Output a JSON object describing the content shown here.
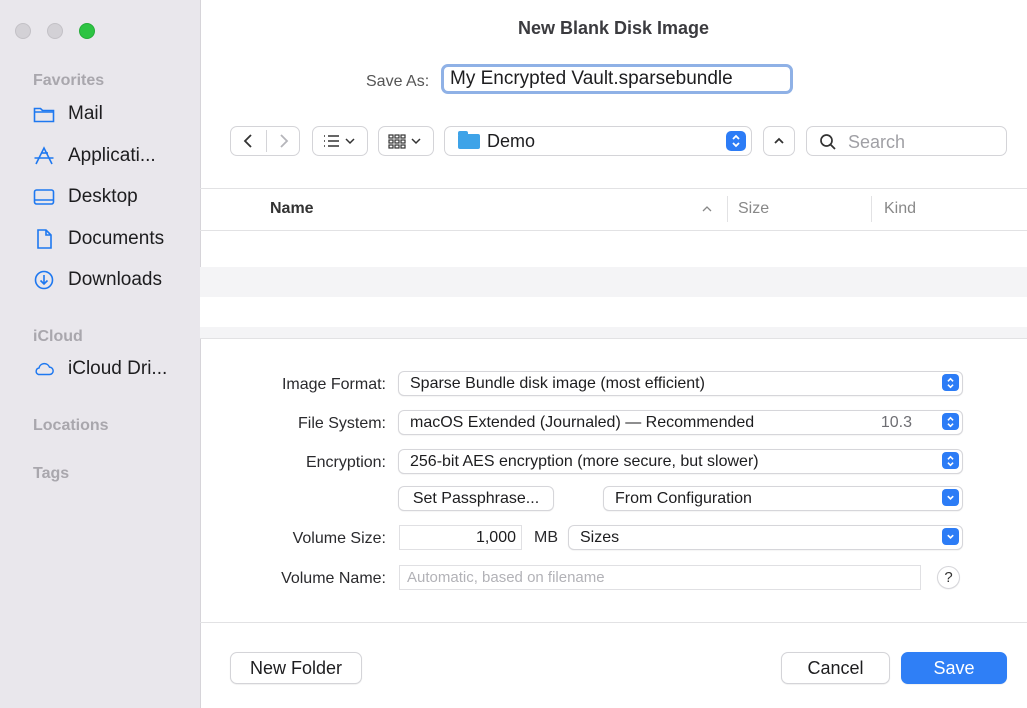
{
  "window": {
    "title": "New Blank Disk Image"
  },
  "sidebar": {
    "sections": {
      "favorites": "Favorites",
      "icloud": "iCloud",
      "locations": "Locations",
      "tags": "Tags"
    },
    "favorites": [
      {
        "label": "Mail",
        "icon": "folder-icon"
      },
      {
        "label": "Applicati...",
        "icon": "applications-icon"
      },
      {
        "label": "Desktop",
        "icon": "desktop-icon"
      },
      {
        "label": "Documents",
        "icon": "document-icon"
      },
      {
        "label": "Downloads",
        "icon": "downloads-icon"
      }
    ],
    "icloud_items": [
      {
        "label": "iCloud Dri...",
        "icon": "cloud-icon"
      }
    ]
  },
  "save_as": {
    "label": "Save As:",
    "value": "My Encrypted Vault.sparsebundle"
  },
  "toolbar": {
    "location": "Demo",
    "search_placeholder": "Search"
  },
  "file_list": {
    "columns": {
      "name": "Name",
      "size": "Size",
      "kind": "Kind"
    },
    "rows": []
  },
  "options": {
    "image_format": {
      "label": "Image Format:",
      "value": "Sparse Bundle disk image (most efficient)"
    },
    "file_system": {
      "label": "File System:",
      "value": "macOS Extended (Journaled) — Recommended",
      "version": "10.3"
    },
    "encryption": {
      "label": "Encryption:",
      "value": "256-bit AES encryption (more secure, but slower)"
    },
    "set_passphrase": "Set Passphrase...",
    "configuration": "From Configuration",
    "volume_size": {
      "label": "Volume Size:",
      "value": "1,000",
      "unit": "MB",
      "preset": "Sizes"
    },
    "volume_name": {
      "label": "Volume Name:",
      "placeholder": "Automatic, based on filename"
    },
    "help": "?"
  },
  "buttons": {
    "new_folder": "New Folder",
    "cancel": "Cancel",
    "save": "Save"
  },
  "colors": {
    "accent": "#2f7ff6",
    "close_dot": "#d3d1d6",
    "zoom_dot": "#2dc443"
  }
}
